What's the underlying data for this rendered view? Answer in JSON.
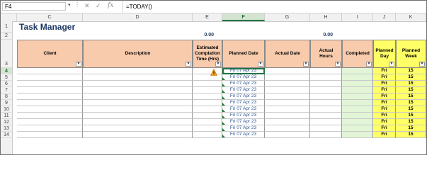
{
  "formula_bar": {
    "name_box": "F4",
    "formula": "=TODAY()",
    "cancel_icon": "✕",
    "enter_icon": "✓",
    "fx_icon": "fx"
  },
  "columns": [
    "C",
    "D",
    "E",
    "F",
    "G",
    "H",
    "I",
    "J",
    "K"
  ],
  "rows": [
    "1",
    "2",
    "3",
    "4",
    "5",
    "6",
    "7",
    "8",
    "9",
    "10",
    "11",
    "12",
    "13",
    "14"
  ],
  "sheet": {
    "title": "Task Manager",
    "total_estimated": "0.00",
    "total_actual": "0.00"
  },
  "headers": {
    "client": "Client",
    "description": "Description",
    "estimated": "Estimated Complation Time (Hrs)",
    "planned_date": "Planned Date",
    "actual_date": "Actual Date",
    "actual_hours": "Actual Hours",
    "completed": "Completed",
    "planned_day": "Planned Day",
    "planned_week": "Planned Week"
  },
  "data_rows": [
    {
      "planned_date": "Fri 07 Apr 23",
      "planned_day": "Fri",
      "planned_week": "15"
    },
    {
      "planned_date": "Fri 07 Apr 23",
      "planned_day": "Fri",
      "planned_week": "15"
    },
    {
      "planned_date": "Fri 07 Apr 23",
      "planned_day": "Fri",
      "planned_week": "15"
    },
    {
      "planned_date": "Fri 07 Apr 23",
      "planned_day": "Fri",
      "planned_week": "15"
    },
    {
      "planned_date": "Fri 07 Apr 23",
      "planned_day": "Fri",
      "planned_week": "15"
    },
    {
      "planned_date": "Fri 07 Apr 23",
      "planned_day": "Fri",
      "planned_week": "15"
    },
    {
      "planned_date": "Fri 07 Apr 23",
      "planned_day": "Fri",
      "planned_week": "15"
    },
    {
      "planned_date": "Fri 07 Apr 23",
      "planned_day": "Fri",
      "planned_week": "15"
    },
    {
      "planned_date": "Fri 07 Apr 23",
      "planned_day": "Fri",
      "planned_week": "15"
    },
    {
      "planned_date": "Fri 07 Apr 23",
      "planned_day": "Fri",
      "planned_week": "15"
    },
    {
      "planned_date": "Fri 07 Apr 23",
      "planned_day": "Fri",
      "planned_week": "15"
    }
  ],
  "colors": {
    "header_orange": "#f8cbad",
    "header_yellow": "#ffff66",
    "completed_green": "#e2f5d6",
    "title_blue": "#1f3864",
    "date_blue": "#2f5597",
    "selection_green": "#217346"
  }
}
